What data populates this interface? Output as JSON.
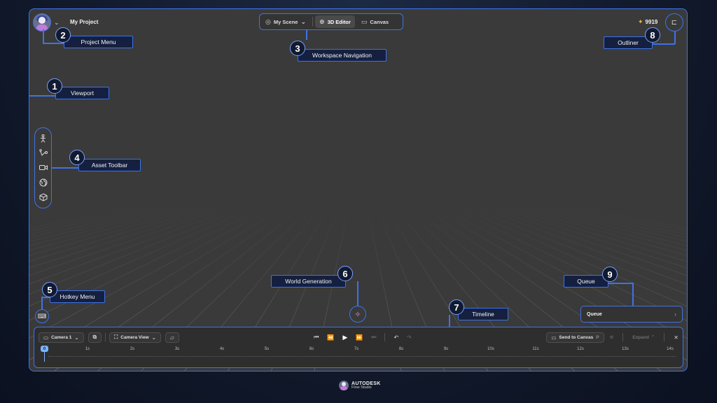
{
  "header": {
    "project_name": "My Project",
    "credits": "9919",
    "workspace_tabs": [
      {
        "label": "My Scene",
        "icon": "globe-icon",
        "has_dropdown": true
      },
      {
        "label": "3D Editor",
        "icon": "target-icon",
        "active": true
      },
      {
        "label": "Canvas",
        "icon": "screen-icon"
      }
    ]
  },
  "asset_toolbar": {
    "items": [
      "character-icon",
      "rig-icon",
      "camera-icon",
      "environment-icon",
      "prop-cube-icon"
    ]
  },
  "queue": {
    "label": "Queue"
  },
  "timeline": {
    "camera_label": "Camera 1",
    "camera_view_label": "Camera View",
    "send_to_canvas_label": "Send to Canvas",
    "send_to_canvas_hotkey": "P",
    "expand_label": "Expand",
    "playhead_value": "0",
    "ticks": [
      "1s",
      "2s",
      "3s",
      "4s",
      "5s",
      "6s",
      "7s",
      "8s",
      "9s",
      "10s",
      "11s",
      "12s",
      "13s",
      "14s"
    ]
  },
  "callouts": [
    {
      "num": "1",
      "label": "Viewport"
    },
    {
      "num": "2",
      "label": "Project Menu"
    },
    {
      "num": "3",
      "label": "Workspace Navigation"
    },
    {
      "num": "4",
      "label": "Asset Toolbar"
    },
    {
      "num": "5",
      "label": "Hotkey Menu"
    },
    {
      "num": "6",
      "label": "World Generation"
    },
    {
      "num": "7",
      "label": "Timeline"
    },
    {
      "num": "8",
      "label": "Outliner"
    },
    {
      "num": "9",
      "label": "Queue"
    }
  ],
  "brand": {
    "line1": "AUTODESK",
    "line2": "Flow Studio"
  },
  "colors": {
    "accent": "#3d73e6",
    "viewport": "#3a3a3a",
    "playhead": "#7ab4ff",
    "credit_star": "#f2b14a"
  }
}
